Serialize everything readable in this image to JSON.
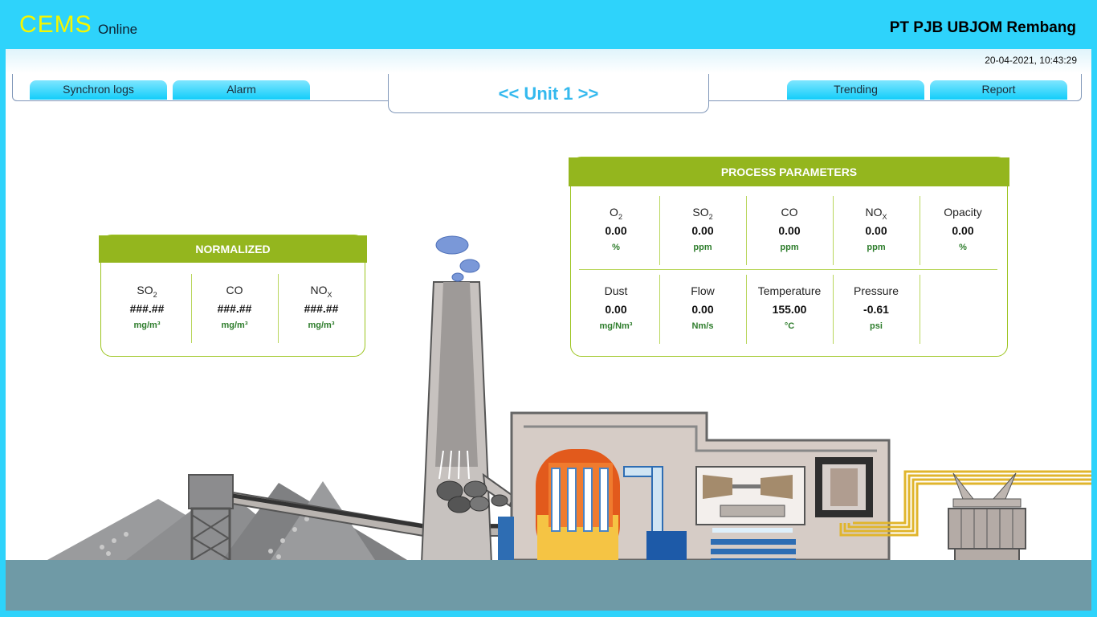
{
  "header": {
    "brand": "CEMS",
    "brand_sub": "Online",
    "company": "PT PJB UBJOM Rembang"
  },
  "datetime": "20-04-2021, 10:43:29",
  "nav": {
    "tabs_left": [
      "Synchron logs",
      "Alarm"
    ],
    "unit_label": "<< Unit 1 >>",
    "tabs_right": [
      "Trending",
      "Report"
    ]
  },
  "normalized": {
    "title": "NORMALIZED",
    "items": [
      {
        "name": "SO",
        "sub": "2",
        "value": "###.##",
        "unit": "mg/m³"
      },
      {
        "name": "CO",
        "sub": "",
        "value": "###.##",
        "unit": "mg/m³"
      },
      {
        "name": "NO",
        "sub": "X",
        "value": "###.##",
        "unit": "mg/m³"
      }
    ]
  },
  "process": {
    "title": "PROCESS PARAMETERS",
    "row1": [
      {
        "name": "O",
        "sub": "2",
        "value": "0.00",
        "unit": "%"
      },
      {
        "name": "SO",
        "sub": "2",
        "value": "0.00",
        "unit": "ppm"
      },
      {
        "name": "CO",
        "sub": "",
        "value": "0.00",
        "unit": "ppm"
      },
      {
        "name": "NO",
        "sub": "X",
        "value": "0.00",
        "unit": "ppm"
      },
      {
        "name": "Opacity",
        "sub": "",
        "value": "0.00",
        "unit": "%"
      }
    ],
    "row2": [
      {
        "name": "Dust",
        "sub": "",
        "value": "0.00",
        "unit": "mg/Nm³"
      },
      {
        "name": "Flow",
        "sub": "",
        "value": "0.00",
        "unit": "Nm/s"
      },
      {
        "name": "Temperature",
        "sub": "",
        "value": "155.00",
        "unit": "°C"
      },
      {
        "name": "Pressure",
        "sub": "",
        "value": "-0.61",
        "unit": "psi"
      }
    ]
  },
  "colors": {
    "frame": "#2ed3fb",
    "brand": "#f6f600",
    "panel_green": "#94b61e",
    "value_unit_green": "#2e7d2c",
    "unit_label": "#34b9ee",
    "water": "#6f9aa6"
  },
  "icons": [
    "chimney-icon",
    "smoke-icon",
    "coal-pile-icon",
    "conveyor-icon",
    "boiler-icon",
    "turbine-icon",
    "generator-icon",
    "transformer-icon"
  ]
}
